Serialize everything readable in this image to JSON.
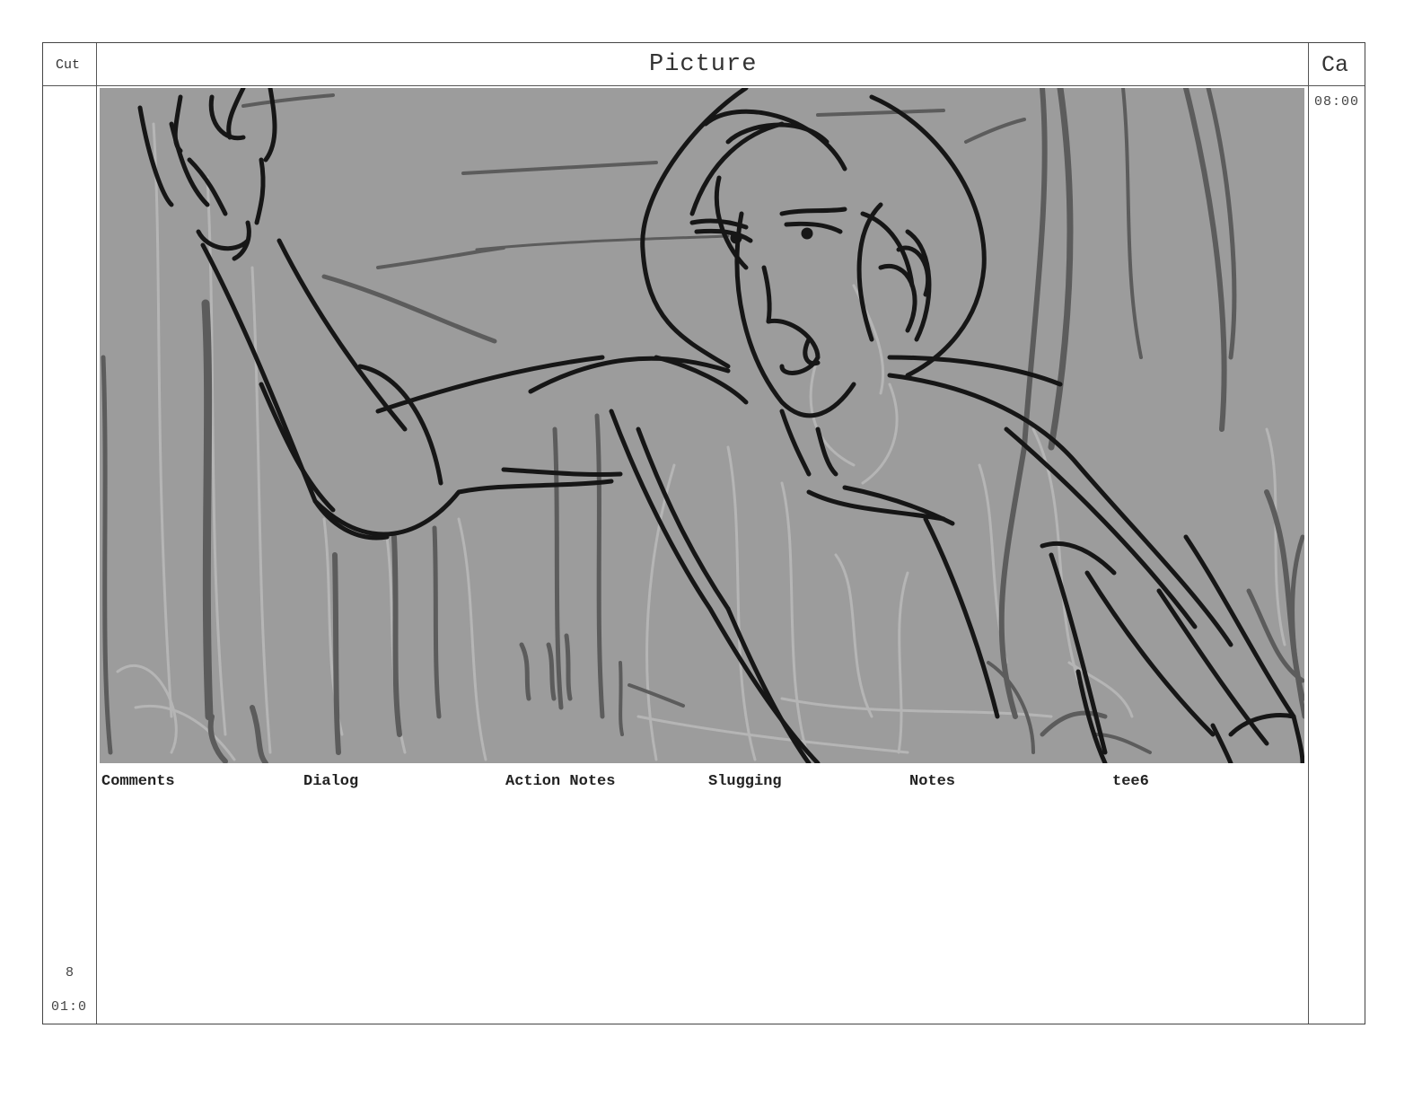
{
  "header": {
    "cut_label": "Cut",
    "picture_label": "Picture",
    "camera_label": "Ca"
  },
  "panel": {
    "duration": "08:00",
    "cut_number": "8",
    "cut_time": "01:0",
    "sketch": {
      "background": "#9c9c9c",
      "ink_dark": "#161616",
      "ink_mid": "#5c5c5c",
      "ink_light": "#b5b5b5"
    }
  },
  "fields": [
    "Comments",
    "Dialog",
    "Action Notes",
    "Slugging",
    "Notes",
    "tee6"
  ]
}
